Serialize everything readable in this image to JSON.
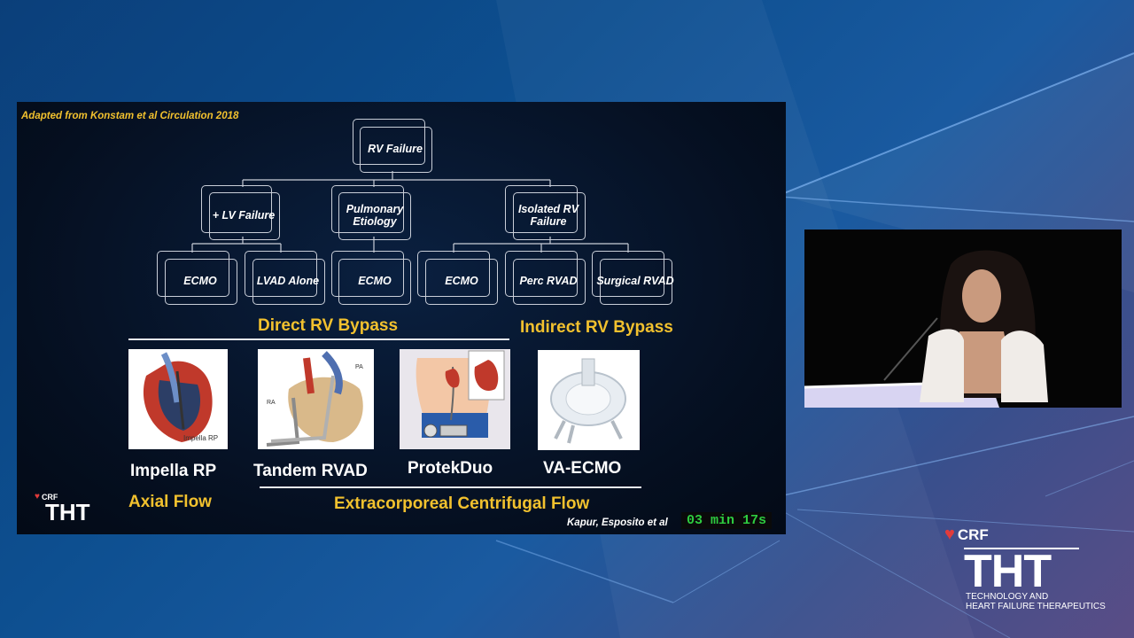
{
  "slide": {
    "attribution": "Adapted from Konstam et al Circulation 2018",
    "tree": {
      "root": "RV Failure",
      "level2": [
        "+ LV Failure",
        "Pulmonary Etiology",
        "Isolated RV Failure"
      ],
      "level3": [
        "ECMO",
        "LVAD Alone",
        "ECMO",
        "ECMO",
        "Perc RVAD",
        "Surgical RVAD"
      ]
    },
    "direct_label": "Direct RV Bypass",
    "indirect_label": "Indirect RV Bypass",
    "devices": [
      {
        "name": "Impella RP",
        "image_caption": "Impella RP"
      },
      {
        "name": "Tandem RVAD",
        "image_caption": ""
      },
      {
        "name": "ProtekDuo",
        "image_caption": ""
      },
      {
        "name": "VA-ECMO",
        "image_caption": ""
      }
    ],
    "axial_label": "Axial Flow",
    "centrifugal_label": "Extracorporeal Centrifugal Flow",
    "citation": "Kapur, Esposito et al",
    "timer": "03 min 17s",
    "logo_small": {
      "brand": "CRF",
      "name": "THT"
    }
  },
  "logo": {
    "brand": "CRF",
    "name": "THT",
    "tagline_1": "TECHNOLOGY AND",
    "tagline_2": "HEART FAILURE THERAPEUTICS"
  },
  "colors": {
    "accent": "#f2c12e",
    "timer": "#2ecc40",
    "heart": "#e23b3b"
  }
}
